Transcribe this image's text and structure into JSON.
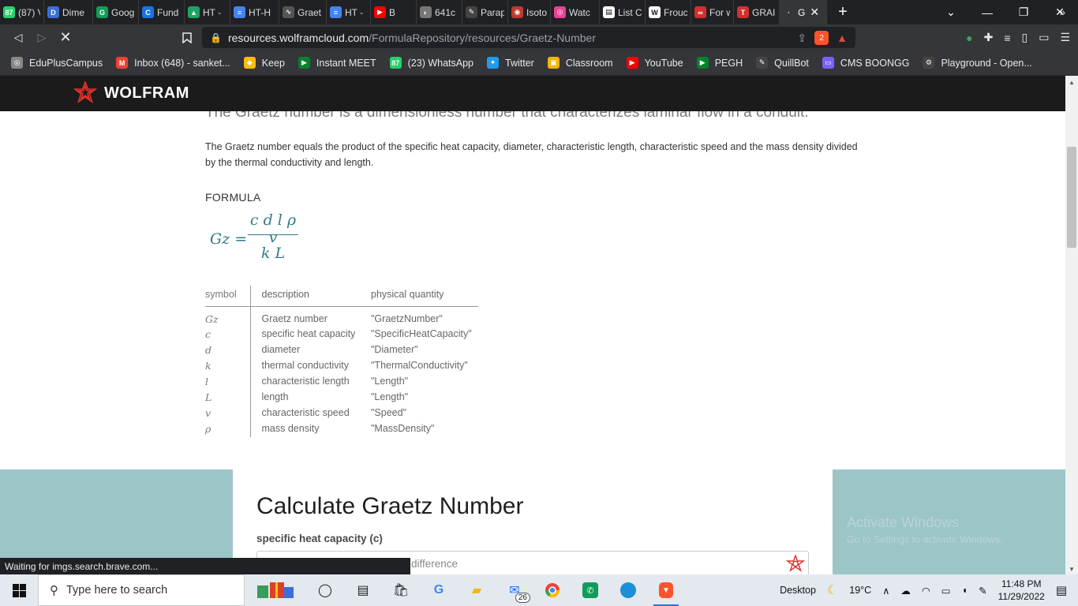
{
  "browser": {
    "tabs": [
      {
        "label": "(87) V",
        "color": "#25d366",
        "glyph": "87"
      },
      {
        "label": "Dime",
        "color": "#3b6fd8",
        "glyph": "D"
      },
      {
        "label": "Goog",
        "color": "#0f9d58",
        "glyph": "G"
      },
      {
        "label": "Fund",
        "color": "#1a73e8",
        "glyph": "C"
      },
      {
        "label": "HT -",
        "color": "#1ea362",
        "glyph": "▲"
      },
      {
        "label": "HT-H",
        "color": "#4285f4",
        "glyph": "≡"
      },
      {
        "label": "Graet",
        "color": "#555555",
        "glyph": "∿"
      },
      {
        "label": "HT -",
        "color": "#4285f4",
        "glyph": "≡"
      },
      {
        "label": "B",
        "color": "#ff0000",
        "glyph": "▶"
      },
      {
        "label": "641c",
        "color": "#777777",
        "glyph": "◐"
      },
      {
        "label": "Parap",
        "color": "#444444",
        "glyph": "✎"
      },
      {
        "label": "Isoto",
        "color": "#c0392b",
        "glyph": "◉"
      },
      {
        "label": "Watc",
        "color": "#e84393",
        "glyph": "◎"
      },
      {
        "label": "List C",
        "color": "#ffffff",
        "glyph": "▤"
      },
      {
        "label": "Frouc",
        "color": "#ffffff",
        "glyph": "W"
      },
      {
        "label": "For w",
        "color": "#d32f2f",
        "glyph": "∞"
      },
      {
        "label": "GRAI",
        "color": "#d32f2f",
        "glyph": "T"
      },
      {
        "label": "G",
        "color": "#35363a",
        "glyph": "·"
      }
    ],
    "url_host": "resources.wolframcloud.com",
    "url_path": "/FormulaRepository/resources/Graetz-Number",
    "brave_badge": "2",
    "bookmarks": [
      {
        "label": "EduPlusCampus",
        "color": "#888888",
        "glyph": "◎"
      },
      {
        "label": "Inbox (648) - sanket...",
        "color": "#ea4335",
        "glyph": "M"
      },
      {
        "label": "Keep",
        "color": "#fbbc04",
        "glyph": "◆"
      },
      {
        "label": "Instant MEET",
        "color": "#00832d",
        "glyph": "▶"
      },
      {
        "label": "(23) WhatsApp",
        "color": "#25d366",
        "glyph": "87"
      },
      {
        "label": "Twitter",
        "color": "#1d9bf0",
        "glyph": "✦"
      },
      {
        "label": "Classroom",
        "color": "#f4b400",
        "glyph": "▣"
      },
      {
        "label": "YouTube",
        "color": "#ff0000",
        "glyph": "▶"
      },
      {
        "label": "PEGH",
        "color": "#00832d",
        "glyph": "▶"
      },
      {
        "label": "QuillBot",
        "color": "#444444",
        "glyph": "✎"
      },
      {
        "label": "CMS BOONGG",
        "color": "#7b61ff",
        "glyph": "▭"
      },
      {
        "label": "Playground - Open...",
        "color": "#444444",
        "glyph": "⚙"
      }
    ],
    "status_text": "Waiting for imgs.search.brave.com..."
  },
  "site": {
    "brand": "WOLFRAM"
  },
  "article": {
    "lead": "The Graetz number is a dimensionless number that characterizes laminar flow in a conduit.",
    "description": "The Graetz number equals the product of the specific heat capacity, diameter, characteristic length, characteristic speed and the mass density divided by the thermal conductivity and length.",
    "formula_heading": "FORMULA",
    "formula": {
      "lhs": "Gz =",
      "numerator": "c d l ρ v",
      "denominator": "k L"
    },
    "table": {
      "headers": [
        "symbol",
        "description",
        "physical quantity"
      ],
      "rows": [
        {
          "symbol": "Gz",
          "description": "Graetz number",
          "quantity": "\"GraetzNumber\""
        },
        {
          "symbol": "c",
          "description": "specific heat capacity",
          "quantity": "\"SpecificHeatCapacity\""
        },
        {
          "symbol": "d",
          "description": "diameter",
          "quantity": "\"Diameter\""
        },
        {
          "symbol": "k",
          "description": "thermal conductivity",
          "quantity": "\"ThermalConductivity\""
        },
        {
          "symbol": "l",
          "description": "characteristic length",
          "quantity": "\"Length\""
        },
        {
          "symbol": "L",
          "description": "length",
          "quantity": "\"Length\""
        },
        {
          "symbol": "v",
          "description": "characteristic speed",
          "quantity": "\"Speed\""
        },
        {
          "symbol": "ρ",
          "description": "mass density",
          "quantity": "\"MassDensity\""
        }
      ]
    }
  },
  "calculator": {
    "title": "Calculate Graetz Number",
    "field_label": "specific heat capacity (c)",
    "field_placeholder": "difference"
  },
  "watermark": {
    "line1": "Activate Windows",
    "line2": "Go to Settings to activate Windows."
  },
  "taskbar": {
    "search_placeholder": "Type here to search",
    "mail_badge": "26",
    "desktop_label": "Desktop",
    "weather": "19°C",
    "time": "11:48 PM",
    "date": "11/29/2022"
  }
}
